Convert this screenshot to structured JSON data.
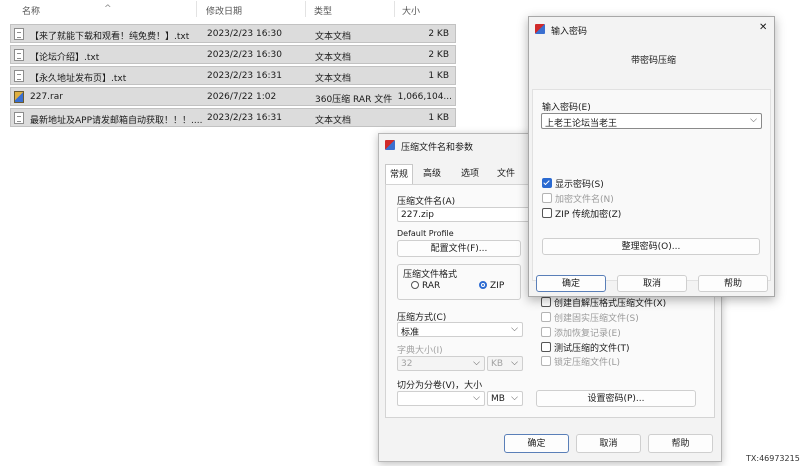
{
  "file_list": {
    "columns": [
      "名称",
      "修改日期",
      "类型",
      "大小"
    ],
    "sort_indicator": "^",
    "rows": [
      {
        "name": "【来了就能下载和观看！纯免费！】.txt",
        "date": "2023/2/23 16:30",
        "type": "文本文档",
        "size": "2 KB",
        "icon": "text-file-icon"
      },
      {
        "name": "【论坛介绍】.txt",
        "date": "2023/2/23 16:30",
        "type": "文本文档",
        "size": "2 KB",
        "icon": "text-file-icon"
      },
      {
        "name": "【永久地址发布页】.txt",
        "date": "2023/2/23 16:31",
        "type": "文本文档",
        "size": "1 KB",
        "icon": "text-file-icon"
      },
      {
        "name": "227.rar",
        "date": "2026/7/22 1:02",
        "type": "360压缩 RAR 文件",
        "size": "1,066,104...",
        "icon": "rar-archive-icon"
      },
      {
        "name": "最新地址及APP请发邮箱自动获取！！！....",
        "date": "2023/2/23 16:31",
        "type": "文本文档",
        "size": "1 KB",
        "icon": "text-file-icon"
      }
    ]
  },
  "archive_dialog": {
    "title": "压缩文件名和参数",
    "tabs": [
      "常规",
      "高级",
      "选项",
      "文件"
    ],
    "archive_name_label": "压缩文件名(A)",
    "archive_name_value": "227.zip",
    "profile_label": "Default Profile",
    "profile_button": "配置文件(F)...",
    "format_group_label": "压缩文件格式",
    "format_rar": "RAR",
    "format_zip": "ZIP",
    "method_label": "压缩方式(C)",
    "method_value": "标准",
    "dict_label": "字典大小(I)",
    "dict_value": "32",
    "dict_unit": "KB",
    "split_label": "切分为分卷(V)，大小",
    "split_value": "",
    "split_unit": "MB",
    "options": [
      {
        "label": "创建自解压格式压缩文件(X)",
        "checked": false,
        "disabled": false
      },
      {
        "label": "创建固实压缩文件(S)",
        "checked": false,
        "disabled": true
      },
      {
        "label": "添加恢复记录(E)",
        "checked": false,
        "disabled": true
      },
      {
        "label": "测试压缩的文件(T)",
        "checked": false,
        "disabled": false
      },
      {
        "label": "锁定压缩文件(L)",
        "checked": false,
        "disabled": true
      }
    ],
    "set_password_button": "设置密码(P)...",
    "ok": "确定",
    "cancel": "取消",
    "help": "帮助"
  },
  "password_dialog": {
    "title": "输入密码",
    "close_glyph": "✕",
    "heading": "带密码压缩",
    "password_label": "输入密码(E)",
    "password_value": "上老王论坛当老王",
    "options": [
      {
        "label": "显示密码(S)",
        "checked": true,
        "disabled": false
      },
      {
        "label": "加密文件名(N)",
        "checked": false,
        "disabled": true
      },
      {
        "label": "ZIP 传统加密(Z)",
        "checked": false,
        "disabled": false
      }
    ],
    "organize_button": "整理密码(O)...",
    "ok": "确定",
    "cancel": "取消",
    "help": "帮助"
  },
  "watermark": "TX:46973215",
  "accent_color": "#2b6ad1"
}
